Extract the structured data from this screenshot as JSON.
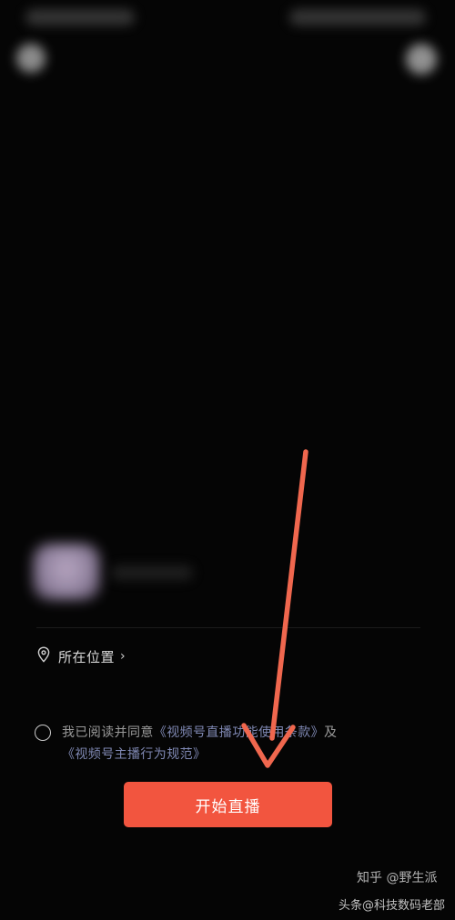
{
  "location": {
    "label": "所在位置",
    "chevron": "›",
    "icon": "location-pin-icon"
  },
  "agreement": {
    "prefix": "我已阅读并同意",
    "terms_link": "《视频号直播功能使用条款》",
    "conjunction": "及",
    "code_link": "《视频号主播行为规范》"
  },
  "start_button": {
    "label": "开始直播"
  },
  "watermarks": {
    "zhihu": "知乎 @野生派",
    "toutiao": "头条@科技数码老部"
  },
  "colors": {
    "background": "#050505",
    "primary_button": "#f2553f",
    "annotation_arrow": "#f0674e",
    "link": "#7f88b3"
  }
}
